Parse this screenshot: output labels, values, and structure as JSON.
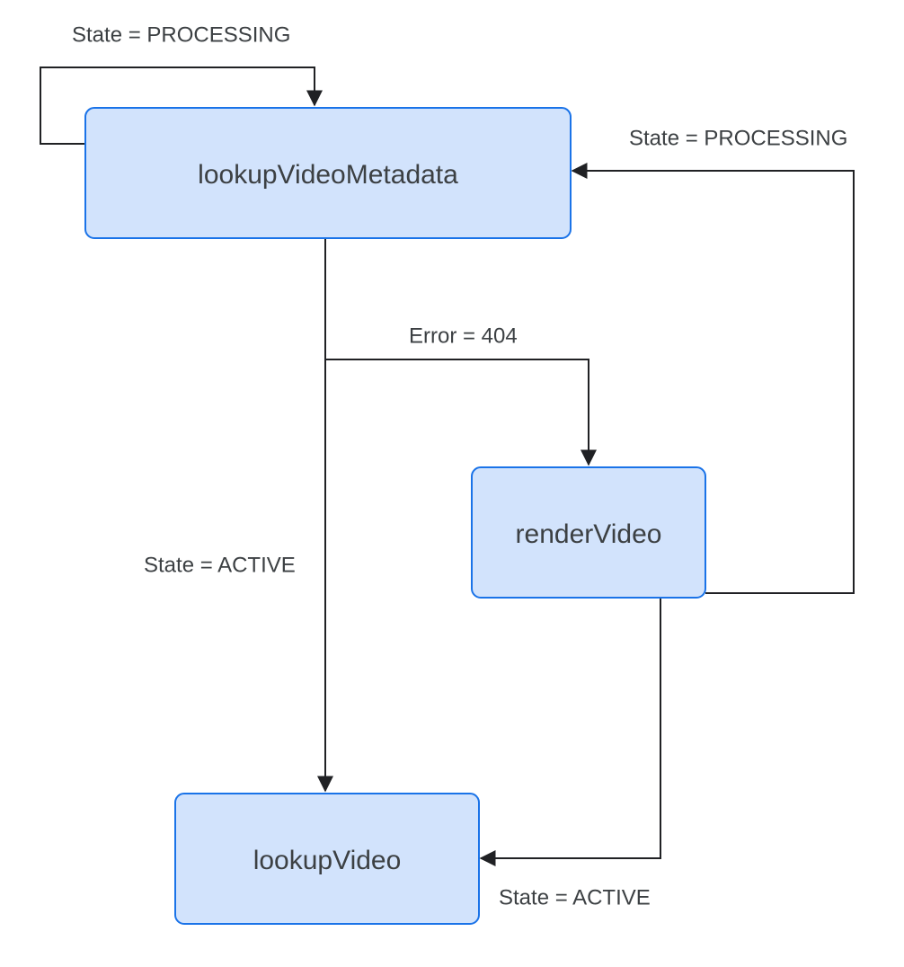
{
  "diagram": {
    "type": "state-flow",
    "nodes": {
      "lookupVideoMetadata": {
        "label": "lookupVideoMetadata"
      },
      "renderVideo": {
        "label": "renderVideo"
      },
      "lookupVideo": {
        "label": "lookupVideo"
      }
    },
    "edges": {
      "selfLoopProcessing": {
        "from": "lookupVideoMetadata",
        "to": "lookupVideoMetadata",
        "label": "State = PROCESSING"
      },
      "renderToLookupMetaProcessing": {
        "from": "renderVideo",
        "to": "lookupVideoMetadata",
        "label": "State = PROCESSING"
      },
      "lookupMetaToRender404": {
        "from": "lookupVideoMetadata",
        "to": "renderVideo",
        "label": "Error = 404"
      },
      "lookupMetaToLookupVideoActive": {
        "from": "lookupVideoMetadata",
        "to": "lookupVideo",
        "label": "State = ACTIVE"
      },
      "renderToLookupVideoActive": {
        "from": "renderVideo",
        "to": "lookupVideo",
        "label": "State = ACTIVE"
      }
    },
    "colors": {
      "nodeFill": "#d2e3fc",
      "nodeStroke": "#1a73e8",
      "edge": "#202124",
      "text": "#3c4043"
    }
  }
}
